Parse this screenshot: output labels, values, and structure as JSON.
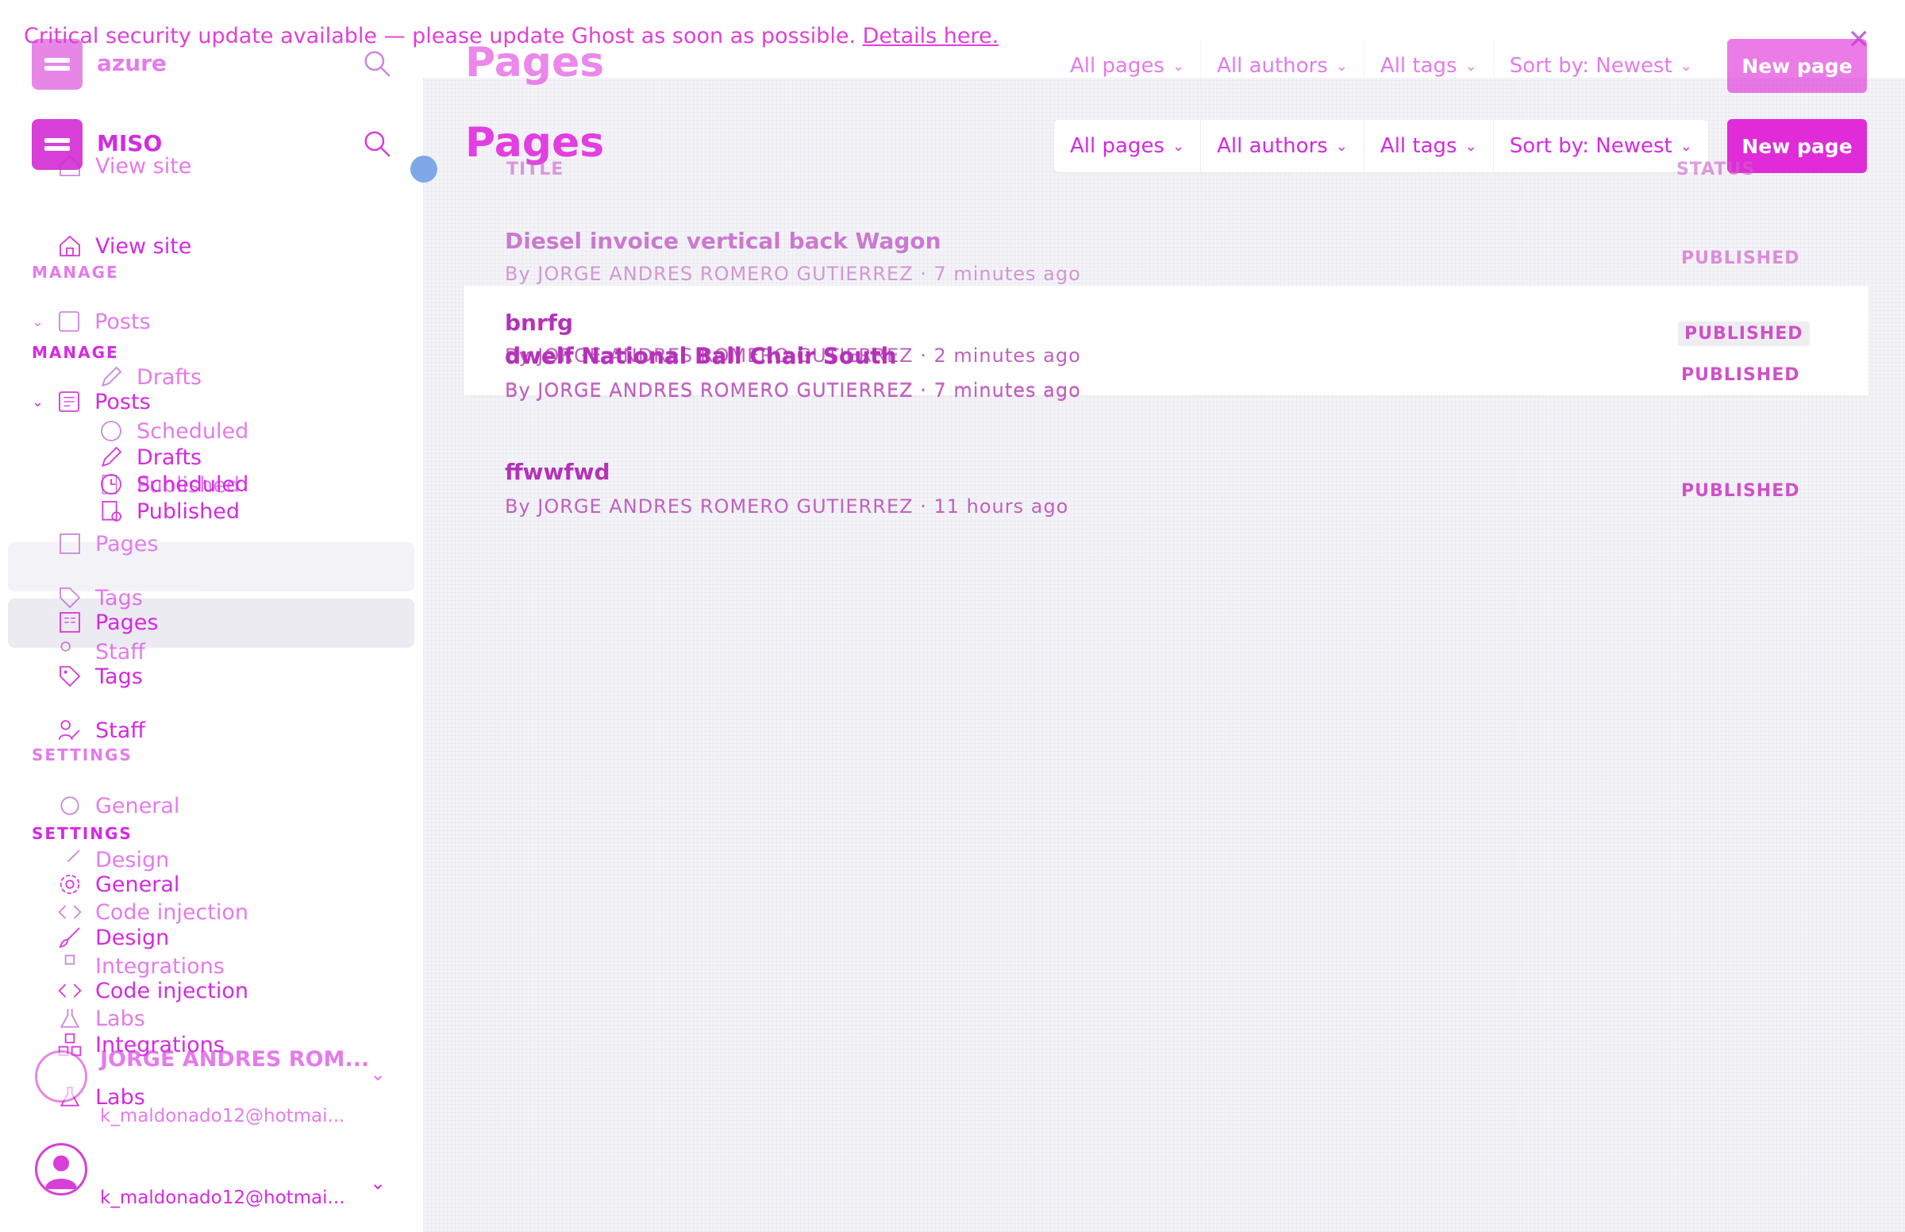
{
  "banner": {
    "text": "Critical security update available — please update Ghost as soon as possible.",
    "link": "Details here.",
    "close_icon": "close-icon"
  },
  "sidebar": {
    "site_name_primary": "MISO",
    "site_name_ghost": "azure",
    "view_site": "View site",
    "manage_label": "MANAGE",
    "settings_label": "SETTINGS",
    "nav": {
      "posts": "Posts",
      "drafts": "Drafts",
      "scheduled": "Scheduled",
      "published": "Published",
      "pages": "Pages",
      "tags": "Tags",
      "staff": "Staff",
      "general": "General",
      "design": "Design",
      "code_injection": "Code injection",
      "integrations": "Integrations",
      "labs": "Labs"
    },
    "user": {
      "name": "JORGE ANDRES ROM...",
      "email": "k_maldonado12@hotmai..."
    }
  },
  "main": {
    "title": "Pages",
    "filters": {
      "pages": "All pages",
      "authors": "All authors",
      "tags": "All tags",
      "sort": "Sort by: Newest"
    },
    "new_button": "New page",
    "columns": {
      "title": "TITLE",
      "status": "STATUS"
    },
    "rows": [
      {
        "title": "bnrfg",
        "author": "By JORGE ANDRES ROMERO GUTIERREZ",
        "time": "2 minutes ago",
        "status": "PUBLISHED"
      },
      {
        "title": "dwelf National Ball Chair South",
        "author": "By JORGE ANDRES ROMERO GUTIERREZ",
        "time": "7 minutes ago",
        "status": "PUBLISHED"
      },
      {
        "title": "ffwwfwd",
        "author": "By JORGE ANDRES ROMERO GUTIERREZ",
        "time": "11 hours ago",
        "status": "PUBLISHED"
      }
    ],
    "ghost_row": {
      "title": "Diesel invoice vertical back Wagon",
      "author": "By JORGE ANDRES ROMERO GUTIERREZ",
      "time": "7 minutes ago",
      "status": "PUBLISHED"
    },
    "time_separator": "·"
  },
  "colors": {
    "accent": "#e02bd8",
    "main_bg": "#f4f4f8"
  }
}
